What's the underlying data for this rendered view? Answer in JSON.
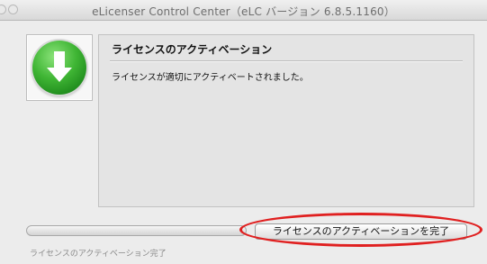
{
  "window": {
    "title": "eLicenser Control Center（eLC バージョン 6.8.5.1160）"
  },
  "panel": {
    "icon": "download-arrow-icon",
    "heading": "ライセンスのアクティベーション",
    "message": "ライセンスが適切にアクティベートされました。"
  },
  "footer": {
    "finish_button": "ライセンスのアクティベーションを完了",
    "status": "ライセンスのアクティベーション完了"
  },
  "colors": {
    "icon_green": "#3fb534",
    "highlight_red": "#e02020"
  }
}
